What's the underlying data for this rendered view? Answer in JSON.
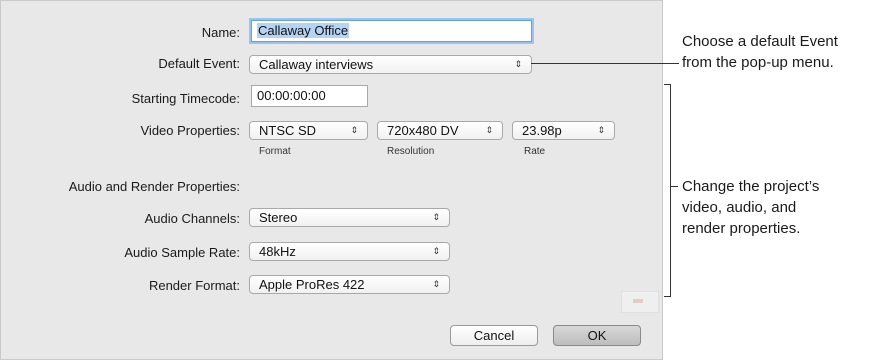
{
  "dialog": {
    "name": {
      "label": "Name:",
      "value": "Callaway Office"
    },
    "default_event": {
      "label": "Default Event:",
      "value": "Callaway interviews"
    },
    "starting_timecode": {
      "label": "Starting Timecode:",
      "value": "00:00:00:00"
    },
    "video_properties": {
      "label": "Video Properties:",
      "format": {
        "value": "NTSC SD",
        "caption": "Format"
      },
      "resolution": {
        "value": "720x480 DV",
        "caption": "Resolution"
      },
      "rate": {
        "value": "23.98p",
        "caption": "Rate"
      }
    },
    "audio_render_heading": "Audio and Render Properties:",
    "audio_channels": {
      "label": "Audio Channels:",
      "value": "Stereo"
    },
    "audio_sample_rate": {
      "label": "Audio Sample Rate:",
      "value": "48kHz"
    },
    "render_format": {
      "label": "Render Format:",
      "value": "Apple ProRes 422"
    },
    "buttons": {
      "cancel": "Cancel",
      "ok": "OK"
    },
    "popup_arrow_glyph": "⌃⌄"
  },
  "callouts": {
    "default_event_line1": "Choose a default Event",
    "default_event_line2": "from the pop-up menu.",
    "properties_line1": "Change the project’s",
    "properties_line2": "video, audio, and",
    "properties_line3": "render properties."
  },
  "icons": [
    "popup-arrows-icon"
  ],
  "colors": {
    "dialog_bg": "#e8e8e8",
    "focus_ring": "#9cc3ee",
    "selection": "#b5d3f3"
  }
}
